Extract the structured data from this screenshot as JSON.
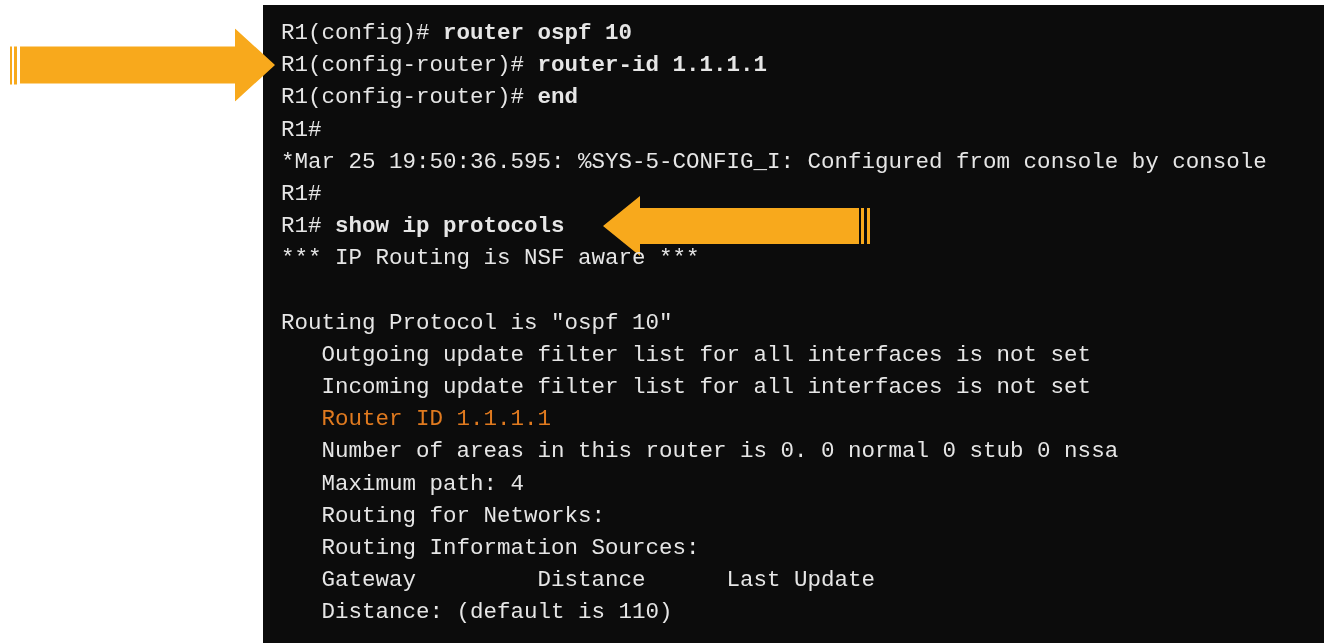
{
  "terminal": {
    "lines": [
      {
        "kind": "prompt",
        "prompt": "R1(config)#",
        "command": "router ospf 10",
        "arrow_from_left": false,
        "arrow_from_right": false
      },
      {
        "kind": "prompt",
        "prompt": "R1(config-router)#",
        "command": "router-id 1.1.1.1",
        "arrow_from_left": true,
        "arrow_from_right": false
      },
      {
        "kind": "prompt",
        "prompt": "R1(config-router)#",
        "command": "end",
        "arrow_from_left": false,
        "arrow_from_right": false
      },
      {
        "kind": "output",
        "text": "R1#",
        "arrow_from_left": false,
        "arrow_from_right": false
      },
      {
        "kind": "output",
        "text": "*Mar 25 19:50:36.595: %SYS-5-CONFIG_I: Configured from console by console",
        "arrow_from_left": false,
        "arrow_from_right": false
      },
      {
        "kind": "output",
        "text": "R1#",
        "arrow_from_left": false,
        "arrow_from_right": false
      },
      {
        "kind": "prompt",
        "prompt": "R1#",
        "command": "show ip protocols",
        "arrow_from_left": false,
        "arrow_from_right": true
      },
      {
        "kind": "output",
        "text": "*** IP Routing is NSF aware ***",
        "arrow_from_left": false,
        "arrow_from_right": false
      },
      {
        "kind": "blank",
        "arrow_from_left": false,
        "arrow_from_right": false
      },
      {
        "kind": "output",
        "text": "Routing Protocol is \"ospf 10\"",
        "arrow_from_left": false,
        "arrow_from_right": false,
        "children": [
          {
            "kind": "output",
            "text": "Outgoing update filter list for all interfaces is not set",
            "arrow_from_left": false,
            "arrow_from_right": false
          },
          {
            "kind": "output",
            "text": "Incoming update filter list for all interfaces is not set",
            "arrow_from_left": false,
            "arrow_from_right": false
          },
          {
            "kind": "highlight",
            "text": "Router ID 1.1.1.1",
            "arrow_from_left": false,
            "arrow_from_right": false
          },
          {
            "kind": "output",
            "text": "Number of areas in this router is 0. 0 normal 0 stub 0 nssa",
            "arrow_from_left": false,
            "arrow_from_right": false
          },
          {
            "kind": "output",
            "text": "Maximum path: 4",
            "arrow_from_left": false,
            "arrow_from_right": false
          },
          {
            "kind": "output",
            "text": "Routing for Networks:",
            "arrow_from_left": false,
            "arrow_from_right": false
          },
          {
            "kind": "output",
            "text": "Routing Information Sources:",
            "arrow_from_left": false,
            "arrow_from_right": false
          },
          {
            "kind": "columns",
            "cells": [
              "Gateway",
              "Distance",
              "Last Update"
            ],
            "arrow_from_left": false,
            "arrow_from_right": false
          },
          {
            "kind": "output",
            "text": "Distance: (default is 110)",
            "arrow_from_left": false,
            "arrow_from_right": false
          }
        ]
      }
    ]
  }
}
